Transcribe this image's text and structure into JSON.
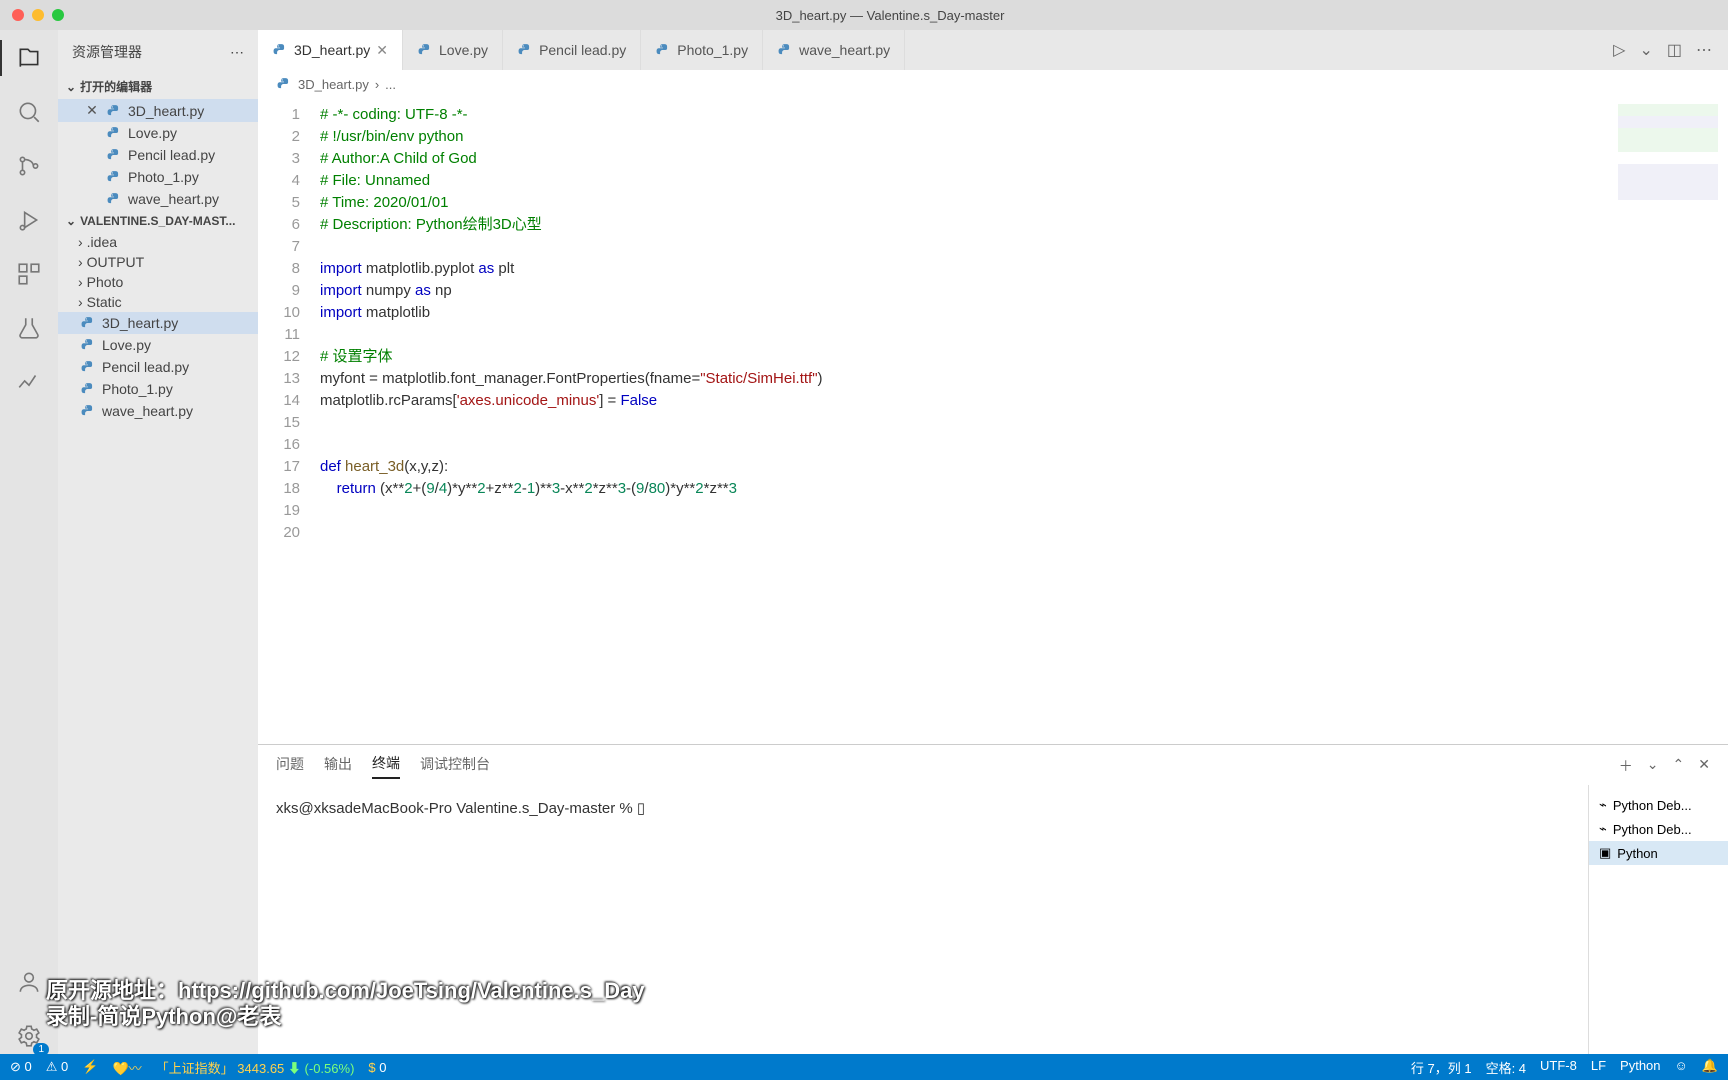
{
  "window": {
    "title": "3D_heart.py — Valentine.s_Day-master"
  },
  "sidebar": {
    "title": "资源管理器",
    "open_editors_label": "打开的编辑器",
    "project_label": "VALENTINE.S_DAY-MAST...",
    "open_editors": [
      {
        "name": "3D_heart.py",
        "active": true
      },
      {
        "name": "Love.py"
      },
      {
        "name": "Pencil lead.py"
      },
      {
        "name": "Photo_1.py"
      },
      {
        "name": "wave_heart.py"
      }
    ],
    "folders": [
      {
        "name": ".idea"
      },
      {
        "name": "OUTPUT"
      },
      {
        "name": "Photo"
      },
      {
        "name": "Static"
      }
    ],
    "files": [
      {
        "name": "3D_heart.py",
        "active": true
      },
      {
        "name": "Love.py"
      },
      {
        "name": "Pencil lead.py"
      },
      {
        "name": "Photo_1.py"
      },
      {
        "name": "wave_heart.py"
      }
    ]
  },
  "tabs": [
    {
      "name": "3D_heart.py",
      "active": true
    },
    {
      "name": "Love.py"
    },
    {
      "name": "Pencil lead.py"
    },
    {
      "name": "Photo_1.py"
    },
    {
      "name": "wave_heart.py"
    }
  ],
  "breadcrumb": {
    "file": "3D_heart.py",
    "more": "..."
  },
  "code": {
    "lines": [
      {
        "n": 1,
        "html": "<span class='com'># -*- coding: UTF-8 -*-</span>"
      },
      {
        "n": 2,
        "html": "<span class='com'># !/usr/bin/env python</span>"
      },
      {
        "n": 3,
        "html": "<span class='com'># Author:A Child of God</span>"
      },
      {
        "n": 4,
        "html": "<span class='com'># File: Unnamed</span>"
      },
      {
        "n": 5,
        "html": "<span class='com'># Time: 2020/01/01</span>"
      },
      {
        "n": 6,
        "html": "<span class='com'># Description: Python绘制3D心型</span>"
      },
      {
        "n": 7,
        "html": ""
      },
      {
        "n": 8,
        "html": "<span class='kw'>import</span> matplotlib.pyplot <span class='kw'>as</span> plt"
      },
      {
        "n": 9,
        "html": "<span class='kw'>import</span> numpy <span class='kw'>as</span> np"
      },
      {
        "n": 10,
        "html": "<span class='kw'>import</span> matplotlib"
      },
      {
        "n": 11,
        "html": ""
      },
      {
        "n": 12,
        "html": "<span class='com'># 设置字体</span>"
      },
      {
        "n": 13,
        "html": "myfont = matplotlib.font_manager.FontProperties(fname=<span class='str'>\"Static/SimHei.ttf\"</span>)"
      },
      {
        "n": 14,
        "html": "matplotlib.rcParams[<span class='str'>'axes.unicode_minus'</span>] = <span class='bool'>False</span>"
      },
      {
        "n": 15,
        "html": ""
      },
      {
        "n": 16,
        "html": ""
      },
      {
        "n": 17,
        "html": "<span class='kw'>def</span> <span class='fn'>heart_3d</span>(x,y,z):"
      },
      {
        "n": 18,
        "html": "    <span class='kw'>return</span> (x**<span class='num'>2</span>+(<span class='num'>9</span>/<span class='num'>4</span>)*y**<span class='num'>2</span>+z**<span class='num'>2</span>-<span class='num'>1</span>)**<span class='num'>3</span>-x**<span class='num'>2</span>*z**<span class='num'>3</span>-(<span class='num'>9</span>/<span class='num'>80</span>)*y**<span class='num'>2</span>*z**<span class='num'>3</span>"
      },
      {
        "n": 19,
        "html": ""
      },
      {
        "n": 20,
        "html": ""
      }
    ]
  },
  "panel": {
    "tabs": {
      "problems": "问题",
      "output": "输出",
      "terminal": "终端",
      "debug": "调试控制台"
    },
    "prompt": "xks@xksadeMacBook-Pro Valentine.s_Day-master % ",
    "cursor": "▯",
    "sessions": [
      {
        "name": "Python Deb..."
      },
      {
        "name": "Python Deb..."
      },
      {
        "name": "Python",
        "active": true
      }
    ]
  },
  "status": {
    "errors": "0",
    "warnings": "0",
    "stock_name": "「上证指数」",
    "stock_value": "3443.65",
    "stock_arrow": "⬇",
    "stock_change": "(-0.56%)",
    "coin": "0",
    "pos": "行 7，列 1",
    "spaces": "空格: 4",
    "encoding": "UTF-8",
    "eol": "LF",
    "lang": "Python"
  },
  "caption": {
    "l1": "原开源地址：https://github.com/JoeTsing/Valentine.s_Day",
    "l2": "录制-简说Python@老表"
  }
}
